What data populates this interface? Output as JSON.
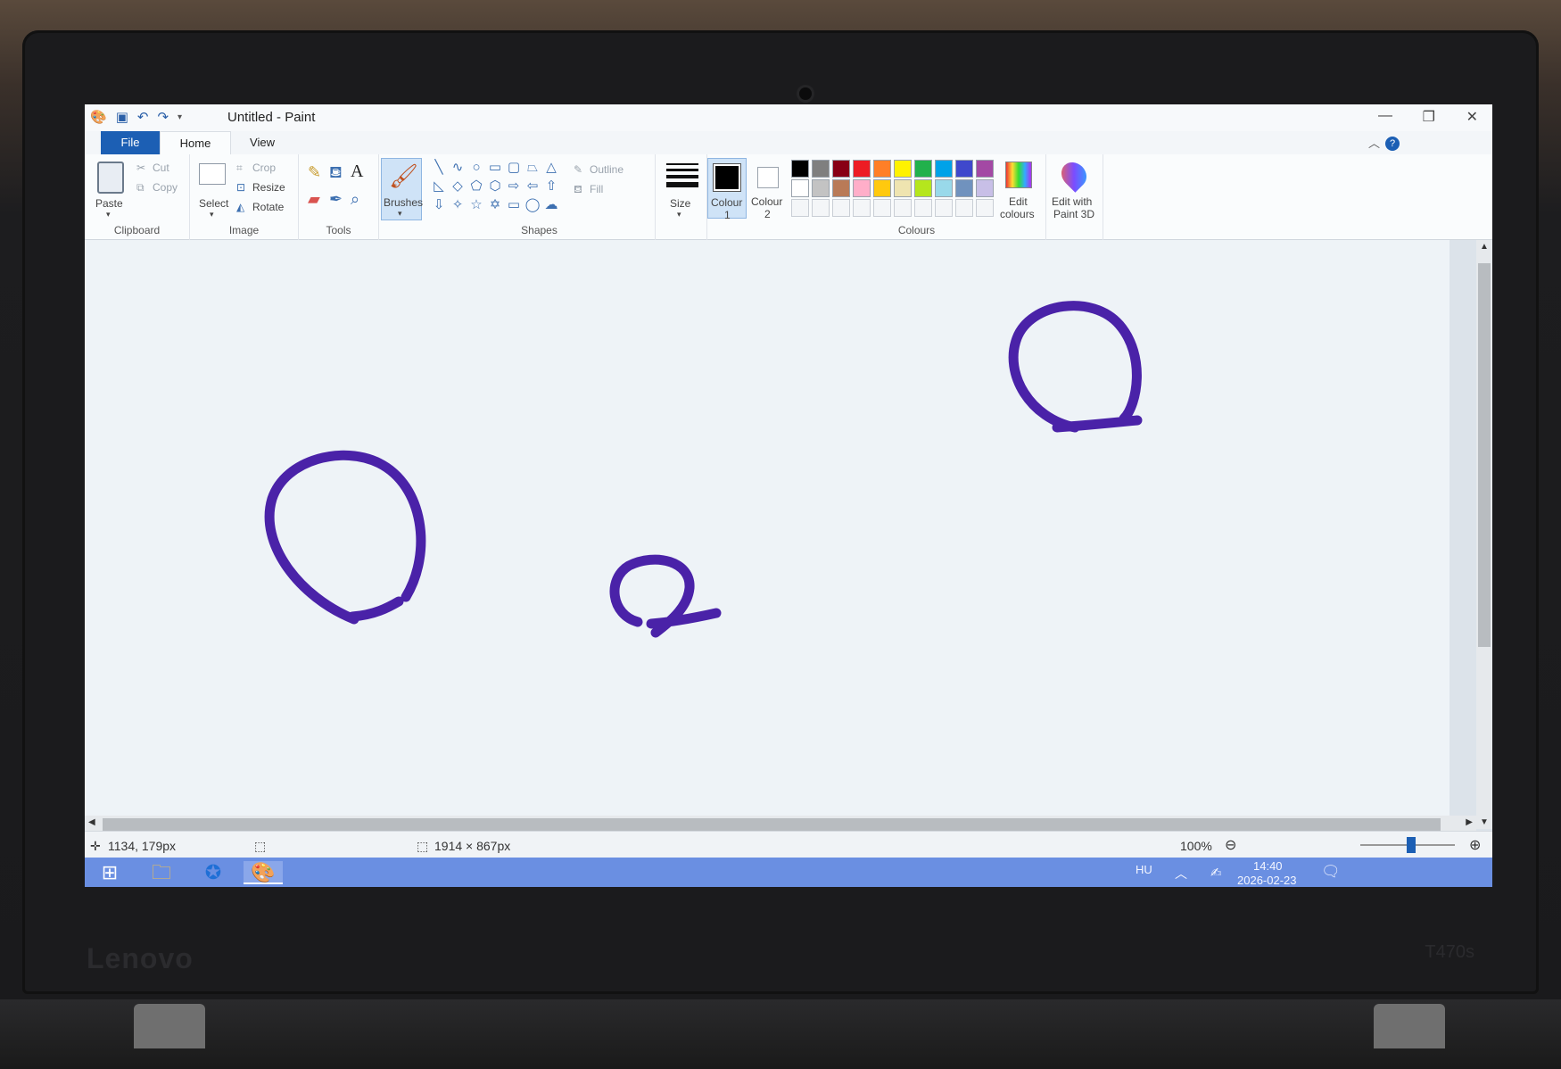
{
  "window": {
    "title": "Untitled - Paint"
  },
  "tabs": {
    "file": "File",
    "home": "Home",
    "view": "View"
  },
  "ribbon": {
    "clipboard": {
      "paste": "Paste",
      "cut": "Cut",
      "copy": "Copy",
      "label": "Clipboard"
    },
    "image": {
      "select": "Select",
      "crop": "Crop",
      "resize": "Resize",
      "rotate": "Rotate",
      "label": "Image"
    },
    "tools": {
      "label": "Tools"
    },
    "brushes": "Brushes",
    "shapes": {
      "outline": "Outline",
      "fill": "Fill",
      "label": "Shapes"
    },
    "size": "Size",
    "colour1": "Colour",
    "colour1_num": "1",
    "colour2": "Colour",
    "colour2_num": "2",
    "colours": {
      "label": "Colours",
      "edit_line1": "Edit",
      "edit_line2": "colours",
      "row1": [
        "#000000",
        "#7f7f7f",
        "#880015",
        "#ed1c24",
        "#ff7f27",
        "#fff200",
        "#22b14c",
        "#00a2e8",
        "#3f48cc",
        "#a349a4"
      ],
      "row2": [
        "#ffffff",
        "#c3c3c3",
        "#b97a57",
        "#ffaec9",
        "#ffc90e",
        "#efe4b0",
        "#b5e61d",
        "#99d9ea",
        "#7092be",
        "#c8bfe7"
      ]
    },
    "paint3d_line1": "Edit with",
    "paint3d_line2": "Paint 3D"
  },
  "canvas": {
    "stroke_color": "#4a22a8"
  },
  "status": {
    "cursor_pos": "1134, 179px",
    "image_size": "1914 × 867px",
    "zoom": "100%"
  },
  "taskbar": {
    "lang": "HU",
    "time": "14:40",
    "date": "2026-02-23"
  },
  "bezel": {
    "brand": "Lenovo",
    "model": "T470s"
  }
}
